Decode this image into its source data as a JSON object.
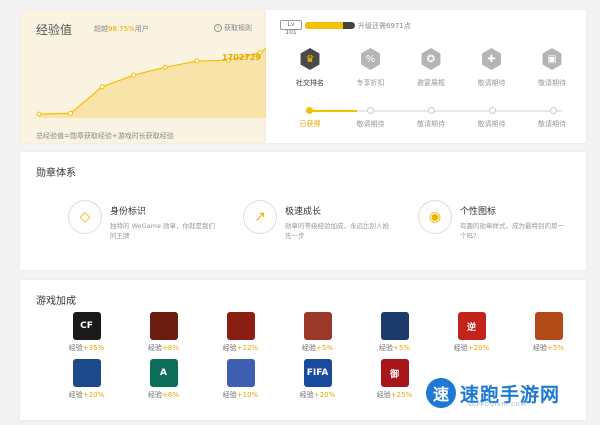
{
  "experience": {
    "title": "经验值",
    "subtitle_prefix": "超越",
    "subtitle_percent": "98.75%",
    "subtitle_suffix": "用户",
    "rules_label": "获取规则",
    "current_value": "1702729",
    "note": "总经验值=勋章获取经验+游戏时长获取经验",
    "chart_data": {
      "type": "area",
      "title": "",
      "xlabel": "",
      "ylabel": "",
      "x": [
        1,
        2,
        3,
        4,
        5,
        6,
        7,
        8
      ],
      "values": [
        5,
        6,
        40,
        55,
        65,
        73,
        74,
        84
      ],
      "ylim": [
        0,
        100
      ],
      "grid": false,
      "legend": "none",
      "colors": {
        "line": "#f5c000",
        "area": "#f8e3a8"
      }
    }
  },
  "level": {
    "badge": "Lv 101",
    "progress_fraction": 0.75,
    "next_text": "升级还需6971点",
    "medals": [
      {
        "name": "社交排名",
        "icon": "crown-icon",
        "glyph": "♛",
        "active": true,
        "status": "已获得"
      },
      {
        "name": "专享折扣",
        "icon": "discount-icon",
        "glyph": "%",
        "active": false,
        "status": "敬请期待"
      },
      {
        "name": "邀宴展框",
        "icon": "medal-icon",
        "glyph": "✪",
        "active": false,
        "status": "敬请期待"
      },
      {
        "name": "敬请期待",
        "icon": "gamepad-icon",
        "glyph": "✚",
        "active": false,
        "status": "敬请期待"
      },
      {
        "name": "敬请期待",
        "icon": "image-icon",
        "glyph": "▣",
        "active": false,
        "status": "敬请期待"
      }
    ]
  },
  "badges": {
    "title": "勋章体系",
    "features": [
      {
        "name": "身份标识",
        "desc": "独特的 WeGame 勋章，你就是我们的王牌",
        "icon": "diamond-icon",
        "glyph": "◇"
      },
      {
        "name": "极速成长",
        "desc": "勋章的等级经验加成，永远比别人抢先一步",
        "icon": "growth-chart-icon",
        "glyph": "↗"
      },
      {
        "name": "个性图标",
        "desc": "有趣的勋章样式，成为最特别的那一个吗？",
        "icon": "badge-icon",
        "glyph": "◉"
      }
    ]
  },
  "games": {
    "title": "游戏加成",
    "exp_label": "经验",
    "items": [
      {
        "icon": "crossfire-icon",
        "label": "CF",
        "color": "#1a1a1a",
        "bonus": "+35%"
      },
      {
        "icon": "dark-fantasy-game-icon",
        "label": "",
        "color": "#6b1d10",
        "bonus": "+8%"
      },
      {
        "icon": "demon-game-icon",
        "label": "",
        "color": "#8a1e12",
        "bonus": "+12%"
      },
      {
        "icon": "sword-game-icon",
        "label": "",
        "color": "#9b3a2a",
        "bonus": "+5%"
      },
      {
        "icon": "starcraft-game-icon",
        "label": "",
        "color": "#1c3a6b",
        "bonus": "+5%"
      },
      {
        "icon": "reverse-game-icon",
        "label": "逆",
        "color": "#c4231b",
        "bonus": "+20%"
      },
      {
        "icon": "basketball-game-icon",
        "label": "",
        "color": "#b24a18",
        "bonus": "+5%"
      },
      {
        "icon": "gun-game-icon",
        "label": "",
        "color": "#1e4a8a",
        "bonus": "+20%"
      },
      {
        "icon": "archeage-icon",
        "label": "A",
        "color": "#0e6e5c",
        "bonus": "+8%"
      },
      {
        "icon": "blade-game-icon",
        "label": "",
        "color": "#3f5fb0",
        "bonus": "+10%"
      },
      {
        "icon": "fifa-online-icon",
        "label": "FIFA",
        "color": "#1a4a9e",
        "bonus": "+20%"
      },
      {
        "icon": "yu-game-icon",
        "label": "御",
        "color": "#a8151a",
        "bonus": "+25%"
      }
    ]
  },
  "watermark": {
    "logo_glyph": "速",
    "text": "速跑手游网",
    "url": "SUPAOQISHI.COM"
  }
}
